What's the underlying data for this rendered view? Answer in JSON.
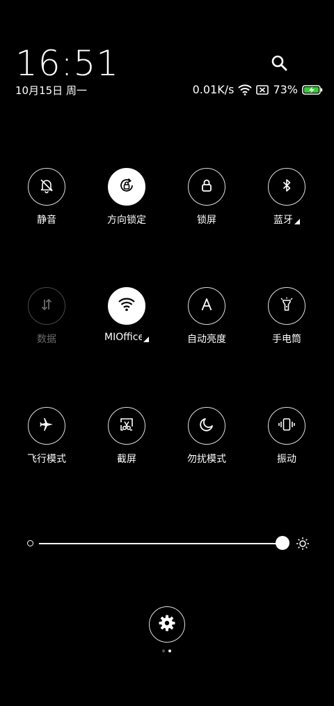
{
  "time": "16:51",
  "date": "10月15日 周一",
  "status": {
    "net_speed": "0.01K/s",
    "battery": "73%"
  },
  "tiles": [
    {
      "label": "静音",
      "icon": "bell-off-icon",
      "state": "off"
    },
    {
      "label": "方向锁定",
      "icon": "rotation-lock-icon",
      "state": "on"
    },
    {
      "label": "锁屏",
      "icon": "lock-icon",
      "state": "off"
    },
    {
      "label": "蓝牙",
      "icon": "bluetooth-icon",
      "state": "off",
      "expand": true
    },
    {
      "label": "数据",
      "icon": "mobile-data-icon",
      "state": "disabled"
    },
    {
      "label": "MIOffice",
      "icon": "wifi-icon",
      "state": "on",
      "expand": true
    },
    {
      "label": "自动亮度",
      "icon": "auto-brightness-icon",
      "state": "off"
    },
    {
      "label": "手电筒",
      "icon": "flashlight-icon",
      "state": "off"
    },
    {
      "label": "飞行模式",
      "icon": "airplane-icon",
      "state": "off"
    },
    {
      "label": "截屏",
      "icon": "screenshot-icon",
      "state": "off"
    },
    {
      "label": "勿扰模式",
      "icon": "moon-icon",
      "state": "off"
    },
    {
      "label": "振动",
      "icon": "vibrate-icon",
      "state": "off"
    }
  ],
  "brightness": {
    "level": 1.0
  },
  "pager": {
    "pages": 2,
    "current": 2
  },
  "colors": {
    "background": "#000000",
    "foreground": "#ffffff",
    "disabled": "#6a6a6a",
    "battery_charge": "#33cc33"
  }
}
